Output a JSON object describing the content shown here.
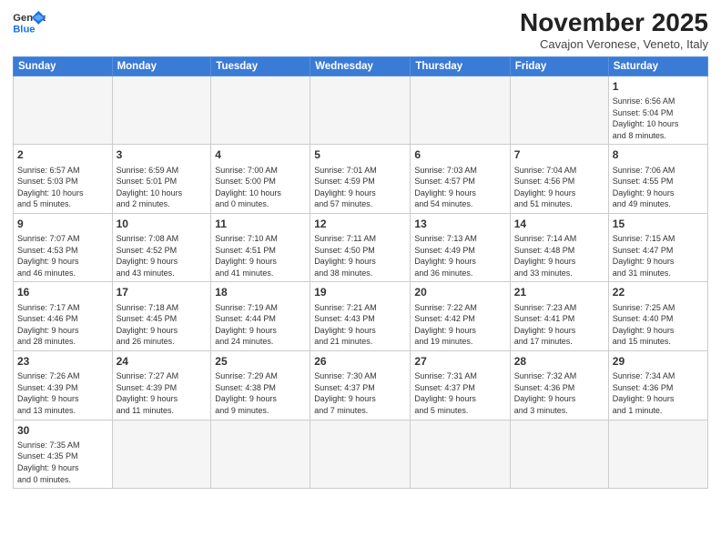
{
  "header": {
    "logo_general": "General",
    "logo_blue": "Blue",
    "month_title": "November 2025",
    "subtitle": "Cavajon Veronese, Veneto, Italy"
  },
  "weekdays": [
    "Sunday",
    "Monday",
    "Tuesday",
    "Wednesday",
    "Thursday",
    "Friday",
    "Saturday"
  ],
  "weeks": [
    [
      {
        "day": "",
        "info": ""
      },
      {
        "day": "",
        "info": ""
      },
      {
        "day": "",
        "info": ""
      },
      {
        "day": "",
        "info": ""
      },
      {
        "day": "",
        "info": ""
      },
      {
        "day": "",
        "info": ""
      },
      {
        "day": "1",
        "info": "Sunrise: 6:56 AM\nSunset: 5:04 PM\nDaylight: 10 hours\nand 8 minutes."
      }
    ],
    [
      {
        "day": "2",
        "info": "Sunrise: 6:57 AM\nSunset: 5:03 PM\nDaylight: 10 hours\nand 5 minutes."
      },
      {
        "day": "3",
        "info": "Sunrise: 6:59 AM\nSunset: 5:01 PM\nDaylight: 10 hours\nand 2 minutes."
      },
      {
        "day": "4",
        "info": "Sunrise: 7:00 AM\nSunset: 5:00 PM\nDaylight: 10 hours\nand 0 minutes."
      },
      {
        "day": "5",
        "info": "Sunrise: 7:01 AM\nSunset: 4:59 PM\nDaylight: 9 hours\nand 57 minutes."
      },
      {
        "day": "6",
        "info": "Sunrise: 7:03 AM\nSunset: 4:57 PM\nDaylight: 9 hours\nand 54 minutes."
      },
      {
        "day": "7",
        "info": "Sunrise: 7:04 AM\nSunset: 4:56 PM\nDaylight: 9 hours\nand 51 minutes."
      },
      {
        "day": "8",
        "info": "Sunrise: 7:06 AM\nSunset: 4:55 PM\nDaylight: 9 hours\nand 49 minutes."
      }
    ],
    [
      {
        "day": "9",
        "info": "Sunrise: 7:07 AM\nSunset: 4:53 PM\nDaylight: 9 hours\nand 46 minutes."
      },
      {
        "day": "10",
        "info": "Sunrise: 7:08 AM\nSunset: 4:52 PM\nDaylight: 9 hours\nand 43 minutes."
      },
      {
        "day": "11",
        "info": "Sunrise: 7:10 AM\nSunset: 4:51 PM\nDaylight: 9 hours\nand 41 minutes."
      },
      {
        "day": "12",
        "info": "Sunrise: 7:11 AM\nSunset: 4:50 PM\nDaylight: 9 hours\nand 38 minutes."
      },
      {
        "day": "13",
        "info": "Sunrise: 7:13 AM\nSunset: 4:49 PM\nDaylight: 9 hours\nand 36 minutes."
      },
      {
        "day": "14",
        "info": "Sunrise: 7:14 AM\nSunset: 4:48 PM\nDaylight: 9 hours\nand 33 minutes."
      },
      {
        "day": "15",
        "info": "Sunrise: 7:15 AM\nSunset: 4:47 PM\nDaylight: 9 hours\nand 31 minutes."
      }
    ],
    [
      {
        "day": "16",
        "info": "Sunrise: 7:17 AM\nSunset: 4:46 PM\nDaylight: 9 hours\nand 28 minutes."
      },
      {
        "day": "17",
        "info": "Sunrise: 7:18 AM\nSunset: 4:45 PM\nDaylight: 9 hours\nand 26 minutes."
      },
      {
        "day": "18",
        "info": "Sunrise: 7:19 AM\nSunset: 4:44 PM\nDaylight: 9 hours\nand 24 minutes."
      },
      {
        "day": "19",
        "info": "Sunrise: 7:21 AM\nSunset: 4:43 PM\nDaylight: 9 hours\nand 21 minutes."
      },
      {
        "day": "20",
        "info": "Sunrise: 7:22 AM\nSunset: 4:42 PM\nDaylight: 9 hours\nand 19 minutes."
      },
      {
        "day": "21",
        "info": "Sunrise: 7:23 AM\nSunset: 4:41 PM\nDaylight: 9 hours\nand 17 minutes."
      },
      {
        "day": "22",
        "info": "Sunrise: 7:25 AM\nSunset: 4:40 PM\nDaylight: 9 hours\nand 15 minutes."
      }
    ],
    [
      {
        "day": "23",
        "info": "Sunrise: 7:26 AM\nSunset: 4:39 PM\nDaylight: 9 hours\nand 13 minutes."
      },
      {
        "day": "24",
        "info": "Sunrise: 7:27 AM\nSunset: 4:39 PM\nDaylight: 9 hours\nand 11 minutes."
      },
      {
        "day": "25",
        "info": "Sunrise: 7:29 AM\nSunset: 4:38 PM\nDaylight: 9 hours\nand 9 minutes."
      },
      {
        "day": "26",
        "info": "Sunrise: 7:30 AM\nSunset: 4:37 PM\nDaylight: 9 hours\nand 7 minutes."
      },
      {
        "day": "27",
        "info": "Sunrise: 7:31 AM\nSunset: 4:37 PM\nDaylight: 9 hours\nand 5 minutes."
      },
      {
        "day": "28",
        "info": "Sunrise: 7:32 AM\nSunset: 4:36 PM\nDaylight: 9 hours\nand 3 minutes."
      },
      {
        "day": "29",
        "info": "Sunrise: 7:34 AM\nSunset: 4:36 PM\nDaylight: 9 hours\nand 1 minute."
      }
    ],
    [
      {
        "day": "30",
        "info": "Sunrise: 7:35 AM\nSunset: 4:35 PM\nDaylight: 9 hours\nand 0 minutes."
      },
      {
        "day": "",
        "info": ""
      },
      {
        "day": "",
        "info": ""
      },
      {
        "day": "",
        "info": ""
      },
      {
        "day": "",
        "info": ""
      },
      {
        "day": "",
        "info": ""
      },
      {
        "day": "",
        "info": ""
      }
    ]
  ]
}
